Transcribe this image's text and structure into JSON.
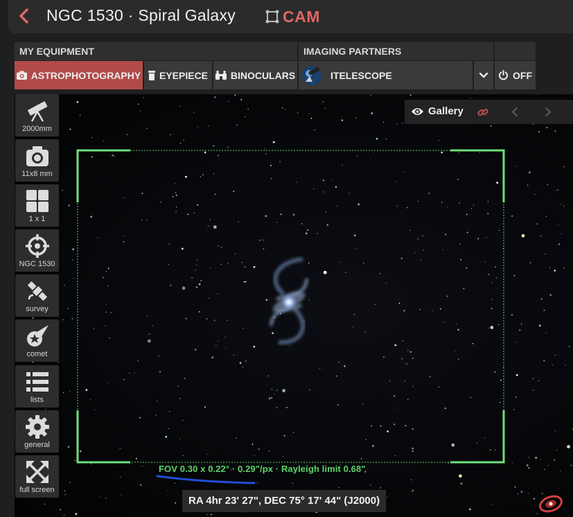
{
  "header": {
    "title": "NGC 1530 · Spiral Galaxy",
    "mode_label": "CAM",
    "back_icon": "chevron-left-icon",
    "mode_icon": "crop-frame-icon"
  },
  "equipment": {
    "my_equipment_heading": "MY EQUIPMENT",
    "imaging_partners_heading": "IMAGING PARTNERS",
    "tabs": [
      {
        "label": "ASTROPHOTOGRAPHY",
        "icon": "camera-icon",
        "active": true
      },
      {
        "label": "EYEPIECE",
        "icon": "eyepiece-icon",
        "active": false
      },
      {
        "label": "BINOCULARS",
        "icon": "binoculars-icon",
        "active": false
      }
    ],
    "partner": {
      "label": "ITELESCOPE",
      "icon": "itelescope-logo"
    },
    "dropdown_icon": "chevron-down-icon",
    "power": {
      "label": "OFF",
      "icon": "power-icon"
    }
  },
  "toolbar": [
    {
      "label": "2000mm",
      "icon": "telescope-icon"
    },
    {
      "label": "11x8 mm",
      "icon": "camera-icon"
    },
    {
      "label": "1 x 1",
      "icon": "grid-icon"
    },
    {
      "label": "NGC 1530",
      "icon": "crosshair-icon"
    },
    {
      "label": "survey",
      "icon": "satellite-icon"
    },
    {
      "label": "comet",
      "icon": "comet-icon"
    },
    {
      "label": "lists",
      "icon": "list-icon"
    },
    {
      "label": "general",
      "icon": "gear-icon"
    },
    {
      "label": "full screen",
      "icon": "fullscreen-icon"
    }
  ],
  "gallery": {
    "label": "Gallery",
    "icons": [
      "eye-icon",
      "link-icon",
      "chevron-left-icon",
      "chevron-right-icon"
    ]
  },
  "fov": {
    "text": "FOV 0.30 x 0.22° · 0.29\"/px · Rayleigh limit 0.68\""
  },
  "coordinates": "RA 4hr 23' 27\", DEC 75° 17' 44\" (J2000)",
  "colors": {
    "accent": "#e06666",
    "active_tab": "#b24a4a",
    "fov_green": "#5fd36a",
    "annotation_blue": "#1e4fd8"
  }
}
